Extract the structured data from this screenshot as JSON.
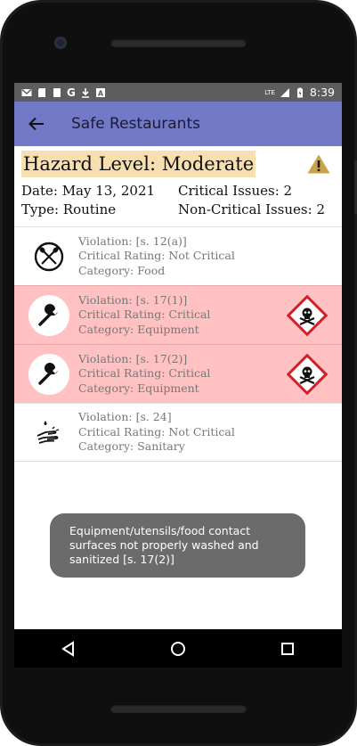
{
  "statusbar": {
    "time": "8:39",
    "network": "LTE",
    "notification_icons": [
      "gmail-icon",
      "sd-card-icon",
      "notes-icon",
      "google-icon",
      "download-icon",
      "a-icon"
    ]
  },
  "appbar": {
    "title": "Safe Restaurants"
  },
  "inspection": {
    "hazard_level": "Hazard Level: Moderate",
    "date": "Date: May 13, 2021",
    "type": "Type: Routine",
    "critical_issues": "Critical Issues: 2",
    "non_critical_issues": "Non-Critical Issues: 2"
  },
  "violations": [
    {
      "violation": "Violation: [s. 12(a)]",
      "rating": "Critical Rating: Not Critical",
      "category": "Category: Food",
      "critical": false,
      "icon": "food-utensils-icon"
    },
    {
      "violation": "Violation: [s. 17(1)]",
      "rating": "Critical Rating: Critical",
      "category": "Category: Equipment",
      "critical": true,
      "icon": "wrench-icon"
    },
    {
      "violation": "Violation: [s. 17(2)]",
      "rating": "Critical Rating: Critical",
      "category": "Category: Equipment",
      "critical": true,
      "icon": "wrench-icon"
    },
    {
      "violation": "Violation: [s. 24]",
      "rating": "Critical Rating: Not Critical",
      "category": "Category: Sanitary",
      "critical": false,
      "icon": "hand-wash-icon"
    }
  ],
  "toast": {
    "message": "Equipment/utensils/food contact surfaces not properly washed and sanitized [s. 17(2)]"
  },
  "colors": {
    "appbar": "#7279c6",
    "hazard_highlight": "#f8dfb0",
    "critical_row": "#ffc1c1",
    "warning_yellow": "#c9a24a",
    "toxic_red": "#d1202a"
  }
}
